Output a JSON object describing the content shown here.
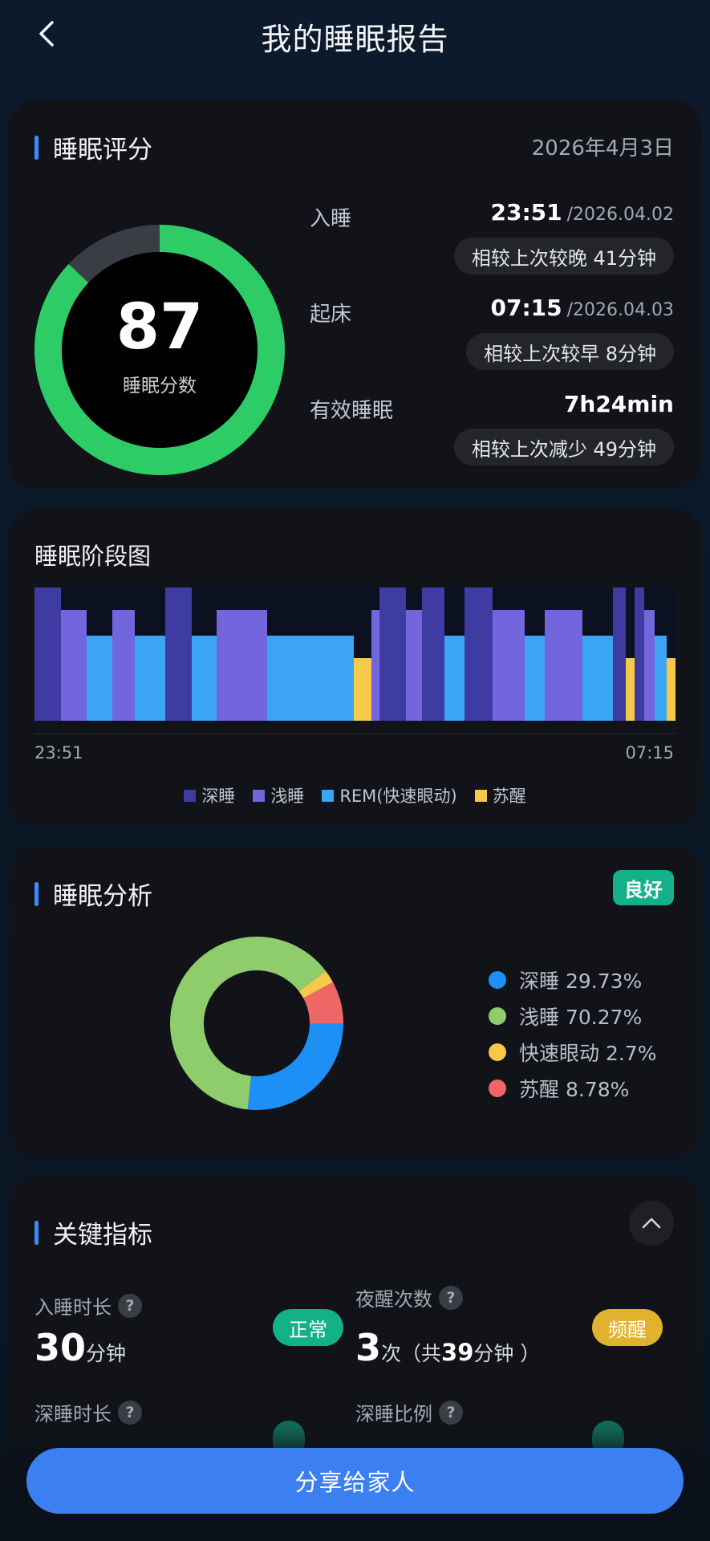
{
  "header": {
    "title": "我的睡眠报告",
    "back_icon": "chevron-left-icon"
  },
  "score_card": {
    "title": "睡眠评分",
    "date": "2026年4月3日",
    "score": "87",
    "score_fraction": 0.87,
    "score_label": "睡眠分数",
    "colors": {
      "ring": "#2ecc66",
      "track": "#3a3d44"
    },
    "sleep_onset": {
      "label": "入睡",
      "time": "23:51",
      "date": "/2026.04.02",
      "compare": "相较上次较晚 41分钟"
    },
    "wake": {
      "label": "起床",
      "time": "07:15",
      "date": "/2026.04.03",
      "compare": "相较上次较早 8分钟"
    },
    "effective": {
      "label": "有效睡眠",
      "value": "7h24min",
      "compare": "相较上次减少 49分钟"
    }
  },
  "stage_card": {
    "title": "睡眠阶段图",
    "start_time": "23:51",
    "end_time": "07:15",
    "legend": [
      {
        "label": "深睡",
        "color": "#3e3ba3"
      },
      {
        "label": "浅睡",
        "color": "#7366dd"
      },
      {
        "label": "REM(快速眼动)",
        "color": "#3ba4f3"
      },
      {
        "label": "苏醒",
        "color": "#f7c948"
      }
    ]
  },
  "analysis_card": {
    "title": "睡眠分析",
    "badge": "良好",
    "items": [
      {
        "label": "深睡 29.73%",
        "value": 29.73,
        "color": "#1e8ff5"
      },
      {
        "label": "浅睡 70.27%",
        "value": 70.27,
        "color": "#8fcc6c"
      },
      {
        "label": "快速眼动 2.7%",
        "value": 2.7,
        "color": "#f7c948"
      },
      {
        "label": "苏醒 8.78%",
        "value": 8.78,
        "color": "#ee6666"
      }
    ]
  },
  "key_card": {
    "title": "关键指标",
    "collapse_icon": "chevron-up-icon",
    "onset_duration": {
      "label": "入睡时长",
      "value": "30",
      "unit": "分钟",
      "tag": "正常"
    },
    "night_wakes": {
      "label": "夜醒次数",
      "value": "3",
      "unit_prefix": "次（共",
      "total": "39",
      "unit_suffix": "分钟 ）",
      "tag": "频醒"
    },
    "deep_duration": {
      "label": "深睡时长"
    },
    "deep_ratio": {
      "label": "深睡比例"
    }
  },
  "share_button": "分享给家人"
}
